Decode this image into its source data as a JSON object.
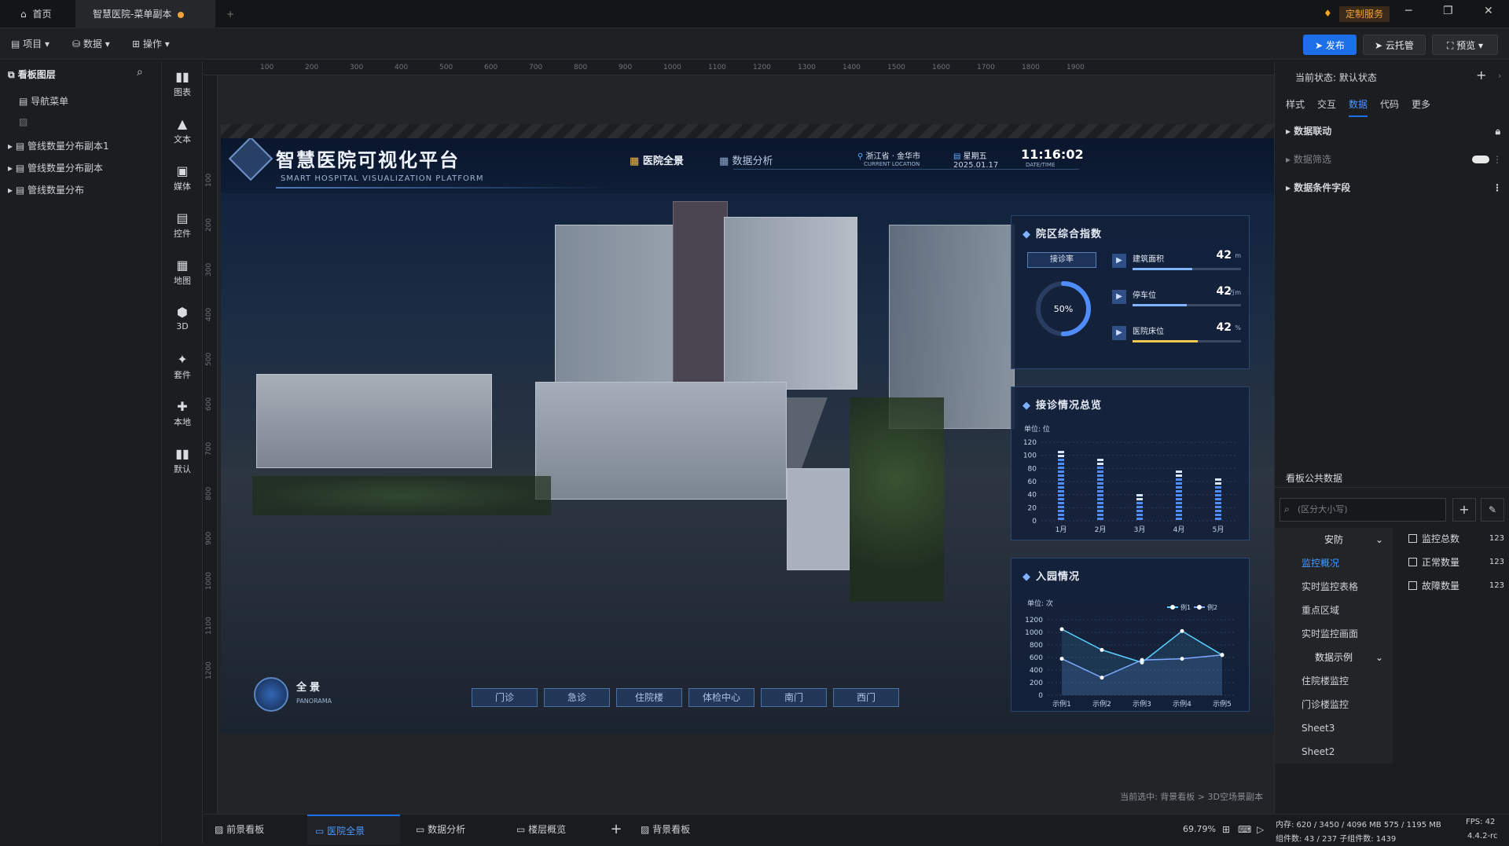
{
  "titlebar": {
    "home_tab": "首页",
    "doc_tab": "智慧医院-菜单副本",
    "custom_service": "定制服务"
  },
  "toolbar": {
    "project": "项目",
    "data": "数据",
    "operate": "操作",
    "publish": "发布",
    "cloud": "云托管",
    "preview": "预览"
  },
  "layers": {
    "title": "看板图层",
    "items": [
      "导航菜单",
      "管线数量分布副本1",
      "管线数量分布副本",
      "管线数量分布"
    ]
  },
  "tools": [
    "图表",
    "文本",
    "媒体",
    "控件",
    "地图",
    "3D",
    "套件",
    "本地",
    "默认"
  ],
  "ruler": {
    "top": [
      "100",
      "200",
      "300",
      "400",
      "500",
      "600",
      "700",
      "800",
      "900",
      "1000",
      "1100",
      "1200",
      "1300",
      "1400",
      "1500",
      "1600",
      "1700",
      "1800",
      "1900"
    ],
    "left": [
      "100",
      "200",
      "300",
      "400",
      "500",
      "600",
      "700",
      "800",
      "900",
      "1000",
      "1100",
      "1200"
    ]
  },
  "dashboard": {
    "title": "智慧医院可视化平台",
    "subtitle": "SMART HOSPITAL VISUALIZATION PLATFORM",
    "nav_overview": "医院全景",
    "nav_analysis": "数据分析",
    "location": "浙江省 · 金华市",
    "location_label": "CURRENT LOCATION",
    "weekday": "星期五",
    "date": "2025.01.17",
    "time": "11:16:02",
    "time_label": "DATE/TIME",
    "panorama": "全景",
    "panorama_en": "PANORAMA",
    "bottom_nav": [
      "门诊",
      "急诊",
      "住院楼",
      "体检中心",
      "南门",
      "西门"
    ],
    "index_panel": {
      "title": "院区综合指数",
      "selector": "接诊率",
      "gauge": "50%",
      "gauge_value": 50,
      "stats": [
        {
          "label": "建筑面积",
          "value": "42",
          "unit": "m",
          "fill": 0.55
        },
        {
          "label": "停车位",
          "value": "42",
          "unit": "万m",
          "fill": 0.5
        },
        {
          "label": "医院床位",
          "value": "42",
          "unit": "%",
          "fill": 0.6
        }
      ]
    },
    "visit_panel": {
      "title": "接诊情况总览",
      "unit": "单位: 位"
    },
    "entry_panel": {
      "title": "入园情况",
      "unit": "单位: 次"
    }
  },
  "chart_data": [
    {
      "type": "bar",
      "title": "接诊情况总览",
      "ylabel": "单位: 位",
      "categories": [
        "1月",
        "2月",
        "3月",
        "4月",
        "5月"
      ],
      "values": [
        110,
        95,
        40,
        80,
        65
      ],
      "ylim": [
        0,
        120
      ],
      "yticks": [
        "120",
        "100",
        "80",
        "60",
        "40",
        "20",
        "0"
      ]
    },
    {
      "type": "line",
      "title": "入园情况",
      "ylabel": "单位: 次",
      "categories": [
        "示例1",
        "示例2",
        "示例3",
        "示例4",
        "示例5"
      ],
      "series": [
        {
          "name": "例1",
          "values": [
            1050,
            720,
            520,
            1020,
            640
          ]
        },
        {
          "name": "例2",
          "values": [
            580,
            280,
            560,
            580,
            640
          ]
        }
      ],
      "ylim": [
        0,
        1200
      ],
      "yticks": [
        "1200",
        "1000",
        "800",
        "600",
        "400",
        "200",
        "0"
      ],
      "legend": "top-right"
    }
  ],
  "props": {
    "state": "当前状态: 默认状态",
    "tabs": [
      "样式",
      "交互",
      "数据",
      "代码",
      "更多"
    ],
    "rows": [
      "数据联动",
      "数据筛选",
      "数据条件字段"
    ],
    "public_data": "看板公共数据",
    "search_placeholder": "(区分大小写)",
    "categories": [
      "安防",
      "监控概况",
      "实时监控表格",
      "重点区域",
      "实时监控画面",
      "数据示例",
      "住院楼监控",
      "门诊楼监控",
      "Sheet3",
      "Sheet2"
    ],
    "fields": [
      {
        "name": "监控总数",
        "value": "123"
      },
      {
        "name": "正常数量",
        "value": "123"
      },
      {
        "name": "故障数量",
        "value": "123"
      }
    ]
  },
  "canvas": {
    "selected": "当前选中: 背景看板 > 3D空场景副本"
  },
  "bottom": {
    "tabs": [
      "前景看板",
      "医院全景",
      "数据分析",
      "楼层概览",
      "背景看板"
    ],
    "zoom": "69.79%"
  },
  "status": {
    "mem": "内存: 620 / 3450 / 4096 MB  575 / 1195 MB",
    "fps": "FPS: 42",
    "count": "组件数: 43 / 237  子组件数: 1439",
    "version": "4.4.2-rc"
  }
}
